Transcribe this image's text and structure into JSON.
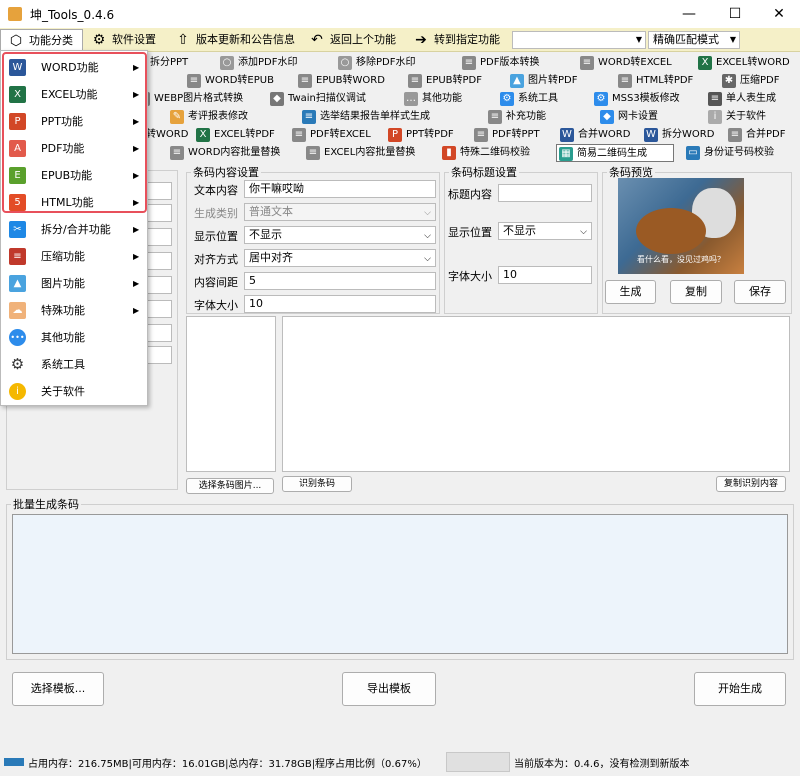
{
  "window": {
    "title": "坤_Tools_0.4.6",
    "min": "—",
    "max": "☐",
    "close": "✕"
  },
  "menubar": {
    "items": [
      {
        "label": "功能分类",
        "icon": "cube-icon"
      },
      {
        "label": "软件设置",
        "icon": "gear-icon"
      },
      {
        "label": "版本更新和公告信息",
        "icon": "arrow-up-circle-icon"
      },
      {
        "label": "返回上个功能",
        "icon": "back-arrow-icon"
      },
      {
        "label": "转到指定功能",
        "icon": "arrow-right-circle-icon"
      }
    ],
    "combo1": "",
    "match_mode": "精确匹配模式"
  },
  "toolbar": {
    "row1": [
      "拆分PPT",
      "添加PDF水印",
      "移除PDF水印",
      "PDF版本转换",
      "WORD转EXCEL",
      "EXCEL转WORD"
    ],
    "row2": [
      "WORD转EPUB",
      "EPUB转WORD",
      "EPUB转PDF",
      "图片转PDF",
      "HTML转PDF",
      "压缩PDF"
    ],
    "row3": [
      "WEBP图片格式转换",
      "Twain扫描仪调试",
      "其他功能",
      "系统工具",
      "MSS3模板修改",
      "单人表生成"
    ],
    "row4": [
      "考评报表修改",
      "选举结果报告单样式生成",
      "补充功能",
      "网卡设置",
      "关于软件"
    ],
    "row5": [
      "转WORD",
      "EXCEL转PDF",
      "PDF转EXCEL",
      "PPT转PDF",
      "PDF转PPT",
      "合并WORD",
      "拆分WORD",
      "合并PDF"
    ],
    "row6": [
      "WORD内容批量替换",
      "EXCEL内容批量替换",
      "特殊二维码校验",
      "简易二维码生成",
      "身份证号码校验"
    ]
  },
  "dropdown": [
    {
      "label": "WORD功能",
      "arrow": "▶",
      "icon": "word-icon",
      "color": "#2b579a",
      "glyph": "W"
    },
    {
      "label": "EXCEL功能",
      "arrow": "▶",
      "icon": "excel-icon",
      "color": "#217346",
      "glyph": "X"
    },
    {
      "label": "PPT功能",
      "arrow": "▶",
      "icon": "ppt-icon",
      "color": "#d24726",
      "glyph": "P"
    },
    {
      "label": "PDF功能",
      "arrow": "▶",
      "icon": "pdf-icon",
      "color": "#e25a4b",
      "glyph": "A"
    },
    {
      "label": "EPUB功能",
      "arrow": "▶",
      "icon": "epub-icon",
      "color": "#5aa02c",
      "glyph": "E"
    },
    {
      "label": "HTML功能",
      "arrow": "▶",
      "icon": "html-icon",
      "color": "#e34c26",
      "glyph": "5"
    },
    {
      "label": "拆分/合并功能",
      "arrow": "▶",
      "icon": "scissors-icon",
      "color": "#1e88e5",
      "glyph": "✂"
    },
    {
      "label": "压缩功能",
      "arrow": "▶",
      "icon": "compress-icon",
      "color": "#c0392b",
      "glyph": "≡"
    },
    {
      "label": "图片功能",
      "arrow": "▶",
      "icon": "image-icon",
      "color": "#4aa3df",
      "glyph": "▲"
    },
    {
      "label": "特殊功能",
      "arrow": "▶",
      "icon": "cloud-icon",
      "color": "#f0b27a",
      "glyph": "☁"
    },
    {
      "label": "其他功能",
      "arrow": "",
      "icon": "more-icon",
      "color": "#2d8ceb",
      "glyph": "•••"
    },
    {
      "label": "系统工具",
      "arrow": "",
      "icon": "gear-icon",
      "color": "#333333",
      "glyph": "⚙"
    },
    {
      "label": "关于软件",
      "arrow": "",
      "icon": "info-icon",
      "color": "#f5b800",
      "glyph": "i"
    }
  ],
  "content_settings": {
    "legend": "条码内容设置",
    "text_label": "文本内容",
    "text_value": "你干嘛哎呦",
    "type_label": "生成类别",
    "type_value": "普通文本",
    "pos_label": "显示位置",
    "pos_value": "不显示",
    "align_label": "对齐方式",
    "align_value": "居中对齐",
    "spacing_label": "内容间距",
    "spacing_value": "5",
    "font_label": "字体大小",
    "font_value": "10"
  },
  "title_settings": {
    "legend": "条码标题设置",
    "title_label": "标题内容",
    "title_value": "",
    "pos_label": "显示位置",
    "pos_value": "不显示",
    "font_label": "字体大小",
    "font_value": "10"
  },
  "preview": {
    "legend": "条码预览",
    "caption": "看什么看，没见过鸡吗？",
    "generate": "生成",
    "copy": "复制",
    "save": "保存"
  },
  "buttons": {
    "select_image": "选择条码图片...",
    "recognize": "识别条码",
    "copy_result": "复制识别内容",
    "select_template": "选择模板...",
    "export_template": "导出模板",
    "start": "开始生成"
  },
  "batch": {
    "legend": "批量生成条码",
    "value": ""
  },
  "status": {
    "memory": "占用内存：216.75MB|可用内存：16.01GB|总内存：31.78GB|程序占用比例（0.67%）",
    "version": "当前版本为：0.4.6，没有检测到新版本"
  },
  "colors": {
    "accent": "#e8505b",
    "menubar": "#f5f0c8",
    "panel": "#ffffff",
    "batch_bg": "#edf4fb"
  }
}
